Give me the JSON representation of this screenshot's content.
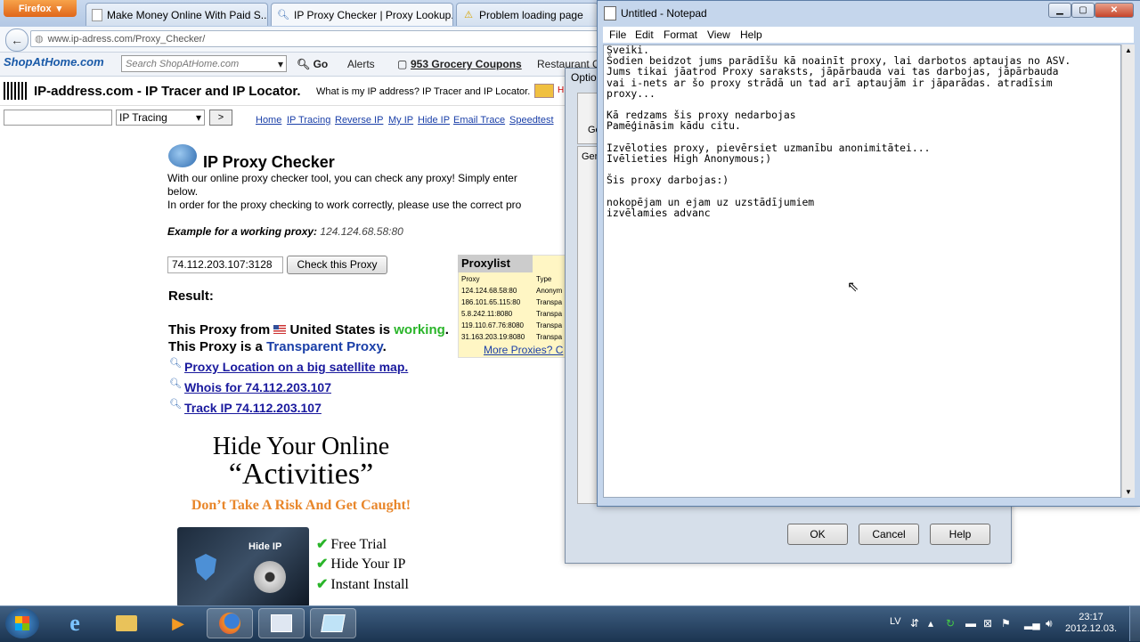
{
  "browser": {
    "app_button": "Firefox",
    "tabs": [
      {
        "label": "Make Money Online With Paid S...",
        "icon": "page-icon"
      },
      {
        "label": "IP Proxy Checker | Proxy Lookup...",
        "icon": "search-icon"
      },
      {
        "label": "Problem loading page",
        "icon": "warning-icon"
      }
    ],
    "url": "www.ip-adress.com/Proxy_Checker/",
    "toolbar": {
      "logo": "ShopAtHome.com",
      "search_placeholder": "Search ShopAtHome.com",
      "go": "Go",
      "alerts": "Alerts",
      "coupons": "953 Grocery Coupons",
      "restaurant": "Restaurant Co"
    }
  },
  "site": {
    "title": "IP-address.com - IP Tracer and IP Locator.",
    "subtitle": "What is my IP address? IP Tracer and IP Locator.",
    "select_value": "IP Tracing",
    "go_btn": ">",
    "nav": [
      "Home",
      "IP Tracing",
      "Reverse IP",
      "My IP",
      "Hide IP",
      "Email Trace",
      "Speedtest"
    ],
    "heading": "IP Proxy Checker",
    "intro1": "With our online proxy checker tool, you can check any proxy! Simply enter",
    "intro2": "below.",
    "intro3": "In order for the proxy checking to work correctly, please use the correct pro",
    "example_label": "Example for a working proxy:",
    "example_value": "124.124.68.58:80",
    "proxy_input": "74.112.203.107:3128",
    "check_button": "Check this Proxy",
    "result_label": "Result:",
    "result1_a": "This Proxy from",
    "result1_country": "United States",
    "result1_b": "is",
    "result1_status": "working",
    "result2_a": "This Proxy is a",
    "result2_type": "Transparent Proxy",
    "links": [
      "Proxy Location on a big satellite map.",
      "Whois for 74.112.203.107",
      "Track IP 74.112.203.107"
    ],
    "proxylist": {
      "title": "Proxylist",
      "col1": "Proxy",
      "col2": "Type",
      "rows": [
        [
          "124.124.68.58:80",
          "Anonym"
        ],
        [
          "186.101.65.115:80",
          "Transpa"
        ],
        [
          "5.8.242.11:8080",
          "Transpa"
        ],
        [
          "119.110.67.76:8080",
          "Transpa"
        ],
        [
          "31.163.203.19:8080",
          "Transpa"
        ]
      ],
      "more": "More Proxies? C"
    },
    "ad": {
      "h1": "Hide Your Online",
      "h2": "“Activities”",
      "tagline": "Don’t Take A Risk And Get Caught!",
      "features": [
        "Free Trial",
        "Hide Your IP",
        "Instant Install"
      ],
      "product": "Hide IP"
    }
  },
  "options_dialog": {
    "title": "Optio",
    "tab1": "Ge",
    "tab2": "Gen",
    "ok": "OK",
    "cancel": "Cancel",
    "help": "Help"
  },
  "notepad": {
    "title": "Untitled - Notepad",
    "menu": [
      "File",
      "Edit",
      "Format",
      "View",
      "Help"
    ],
    "text": "Sveiki.\nŠodien beidzot jums parādīšu kā noainīt proxy, lai darbotos aptaujas no ASV.\nJums tikai jāatrod Proxy saraksts, jāpārbauda vai tas darbojas, jāpārbauda\nvai i-nets ar šo proxy strādā un tad arī aptaujām ir jāparādas. atradīsim\nproxy...\n\nKā redzams šis proxy nedarbojas\nPamēģināsim kādu citu.\n\nIzvēloties proxy, pievērsiet uzmanību anonimitātei...\nIvēlieties High Anonymous;)\n\nŠis proxy darbojas:)\n\nnokopējam un ejam uz uzstādījumiem\nizvēlamies advanc"
  },
  "taskbar": {
    "lang": "LV",
    "time": "23:17",
    "date": "2012.12.03."
  }
}
